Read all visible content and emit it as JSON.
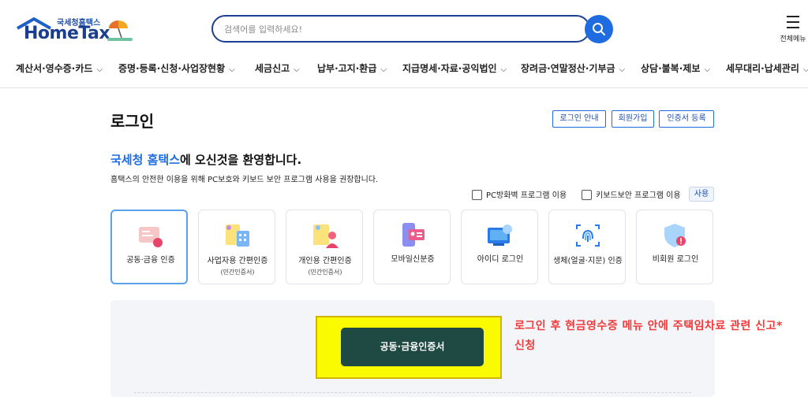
{
  "header": {
    "logo_small": "국세청홈택스",
    "logo_main": "HomeTax",
    "search_placeholder": "검색어를 입력하세요!",
    "allmenu_label": "전체메뉴"
  },
  "nav": {
    "items": [
      {
        "label": "계산서·영수증·카드"
      },
      {
        "label": "증명·등록·신청·사업장현황"
      },
      {
        "label": "세금신고"
      },
      {
        "label": "납부·고지·환급"
      },
      {
        "label": "지급명세·자료·공익법인"
      },
      {
        "label": "장려금·연말정산·기부금"
      },
      {
        "label": "상담·불복·제보"
      },
      {
        "label": "세무대리·납세관리"
      }
    ]
  },
  "main": {
    "title": "로그인",
    "top_buttons": [
      "로그인 안내",
      "회원가입",
      "인증서 등록"
    ],
    "welcome_highlight": "국세청 홈택스",
    "welcome_rest": "에 오신것을 환영합니다.",
    "welcome_sub": "홈택스의 안전한 이용을 위해 PC보호와 키보드 보안 프로그램 사용을 권장합니다.",
    "checkbox_firewall": "PC방화벽 프로그램 이용",
    "checkbox_keyboard": "키보드보안 프로그램 이용",
    "use_button": "사용",
    "login_methods": [
      {
        "title": "공동·금융 인증",
        "sub": "",
        "icon": "certificate-icon"
      },
      {
        "title": "사업자용 간편인증",
        "sub": "(민간인증서)",
        "icon": "business-simple-auth-icon"
      },
      {
        "title": "개인용 간편인증",
        "sub": "(민간인증서)",
        "icon": "personal-simple-auth-icon"
      },
      {
        "title": "모바일신분증",
        "sub": "",
        "icon": "mobile-id-icon"
      },
      {
        "title": "아이디 로그인",
        "sub": "",
        "icon": "id-login-icon"
      },
      {
        "title": "생체(얼굴·지문) 인증",
        "sub": "",
        "icon": "fingerprint-icon"
      },
      {
        "title": "비회원 로그인",
        "sub": "",
        "icon": "guest-shield-icon"
      }
    ],
    "cert_button": "공동·금융인증서",
    "annotation": "로그인 후 현금영수증 메뉴 안에 주택임차료 관련 신고*신청"
  },
  "colors": {
    "brand_navy": "#1c3f94",
    "accent_blue": "#1e6ce0",
    "cert_button": "#1f4a44",
    "highlight_yellow": "#fafa00",
    "annotation_red": "#ef3b3b"
  }
}
